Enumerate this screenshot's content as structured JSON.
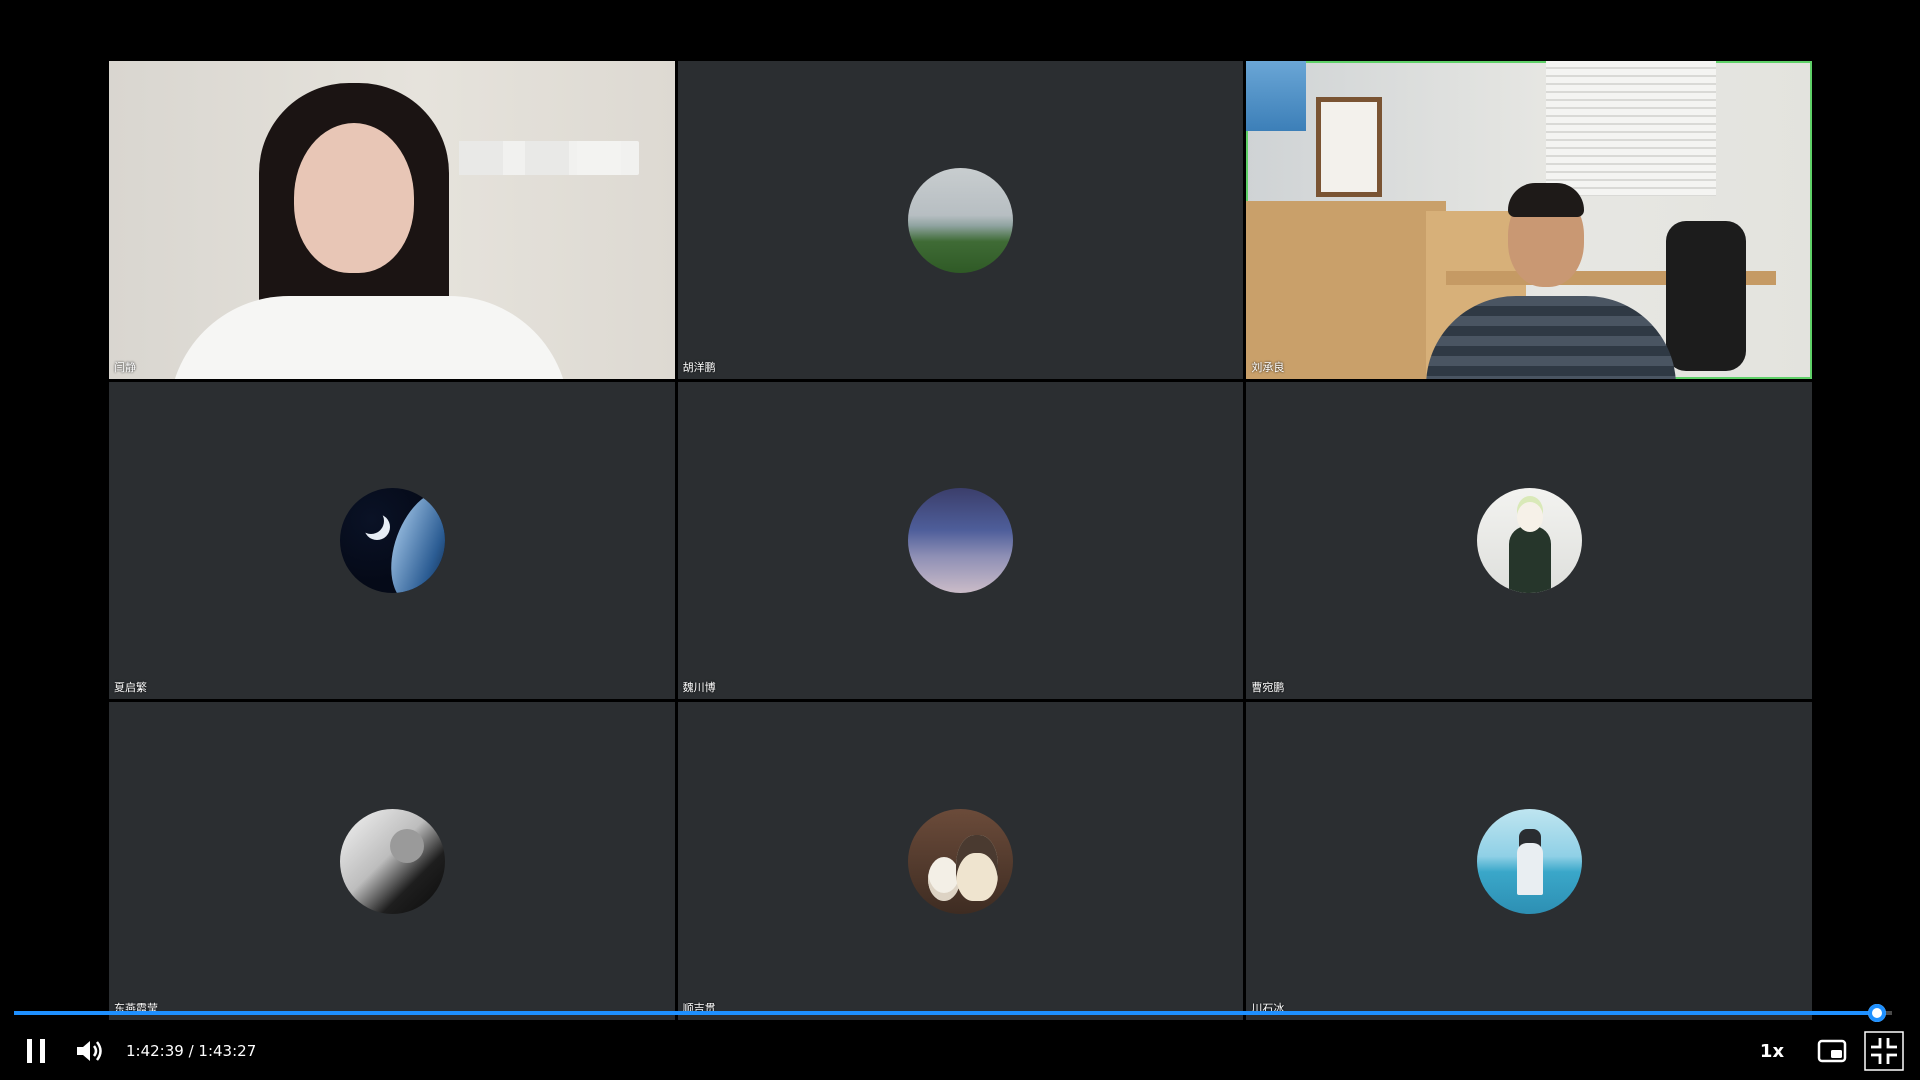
{
  "participants": [
    {
      "name": "闫静",
      "type": "camera"
    },
    {
      "name": "胡洋鹏",
      "type": "avatar",
      "avatar_icon": "lake-landscape-avatar"
    },
    {
      "name": "刘承良",
      "type": "camera",
      "active_speaker": true
    },
    {
      "name": "夏启繁",
      "type": "avatar",
      "avatar_icon": "earth-space-avatar"
    },
    {
      "name": "魏川博",
      "type": "avatar",
      "avatar_icon": "crowd-avatar"
    },
    {
      "name": "曹宛鹏",
      "type": "avatar",
      "avatar_icon": "anime-character-avatar"
    },
    {
      "name": "东燕霞莹",
      "type": "avatar",
      "avatar_icon": "bw-anime-avatar"
    },
    {
      "name": "顺吉贯",
      "type": "avatar",
      "avatar_icon": "plush-toys-avatar"
    },
    {
      "name": "川石冰",
      "type": "avatar",
      "avatar_icon": "sea-person-avatar"
    }
  ],
  "player": {
    "current_time": "1:42:39",
    "duration": "1:43:27",
    "time_display": "1:42:39 / 1:43:27",
    "progress_fraction": 0.992,
    "speed_label": "1x",
    "colors": {
      "accent": "#1e90ff",
      "active_speaker_border": "#5fd068",
      "tile_bg": "#2b2e31"
    },
    "icons": {
      "pause": "pause-icon",
      "volume": "volume-icon",
      "pip": "picture-in-picture-icon",
      "exit_fullscreen": "exit-fullscreen-icon"
    }
  }
}
